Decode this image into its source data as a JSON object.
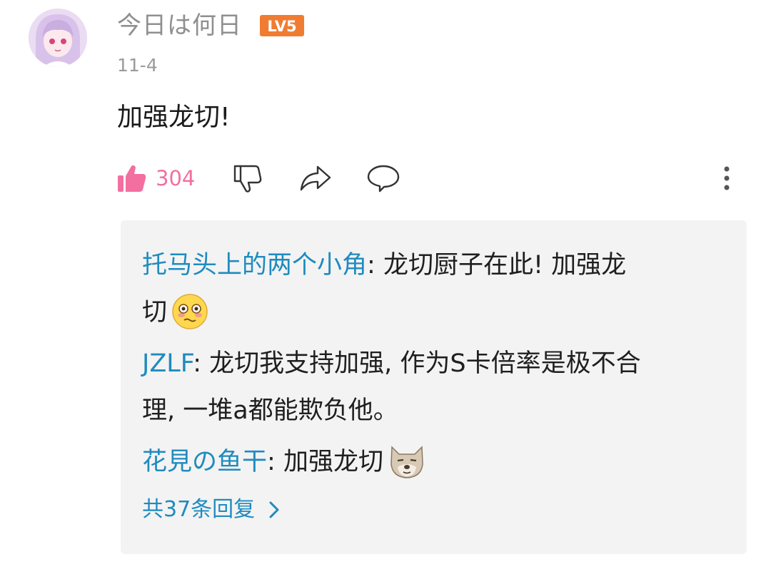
{
  "comment": {
    "username": "今日は何日",
    "level_badge": "LV5",
    "date": "11-4",
    "text": "加强龙切!",
    "likes": "304"
  },
  "actions": {
    "icons": [
      "thumbs-up-icon",
      "thumbs-down-icon",
      "share-icon",
      "comment-icon",
      "more-vertical-icon"
    ]
  },
  "replies": [
    {
      "name": "托马头上的两个小角",
      "sep": ": ",
      "line1": "龙切厨子在此! 加强龙",
      "line2": "切",
      "emoji": "flushed-face-emoji"
    },
    {
      "name": "JZLF",
      "sep": ": ",
      "line1": "龙切我支持加强, 作为S卡倍率是极不合",
      "line2": "理, 一堆a都能欺负他。"
    },
    {
      "name": "花見の鱼干",
      "sep": ": ",
      "text": "加强龙切",
      "emoji": "shiba-dog-emoji"
    }
  ],
  "more_replies": "共37条回复",
  "colors": {
    "name_blue": "#1f8bbf",
    "like_pink": "#f36fa0",
    "level_orange": "#f07c32",
    "gray_text": "#8f8f8f",
    "reply_bg": "#f3f3f3"
  }
}
